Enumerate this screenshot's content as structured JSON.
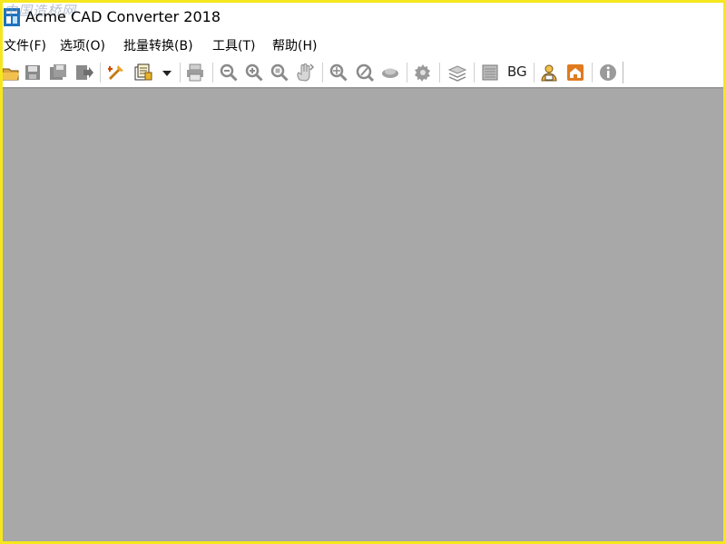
{
  "window": {
    "title": "Acme CAD Converter 2018",
    "watermark": "中国造桥网",
    "frame_color": "#f6e71c"
  },
  "menubar": {
    "items": [
      {
        "label": "文件(F)"
      },
      {
        "label": "选项(O)"
      },
      {
        "label": "批量转换(B)"
      },
      {
        "label": "工具(T)"
      },
      {
        "label": "帮助(H)"
      }
    ]
  },
  "toolbar": {
    "bg_label": "BG",
    "buttons": [
      {
        "icon": "open-icon"
      },
      {
        "icon": "save-icon"
      },
      {
        "icon": "save-as-icon"
      },
      {
        "icon": "export-icon"
      },
      {
        "icon": "convert-icon"
      },
      {
        "icon": "batch-convert-icon"
      },
      {
        "icon": "dropdown-arrow-icon"
      },
      {
        "icon": "print-icon"
      },
      {
        "icon": "zoom-out-icon"
      },
      {
        "icon": "zoom-in-icon"
      },
      {
        "icon": "zoom-window-icon"
      },
      {
        "icon": "pan-icon"
      },
      {
        "icon": "zoom-extents-icon"
      },
      {
        "icon": "zoom-realtime-icon"
      },
      {
        "icon": "view-icon"
      },
      {
        "icon": "settings-icon"
      },
      {
        "icon": "layers-icon"
      },
      {
        "icon": "layout-icon"
      },
      {
        "icon": "background-color-icon"
      },
      {
        "icon": "user-icon"
      },
      {
        "icon": "home-icon"
      },
      {
        "icon": "info-icon"
      }
    ]
  },
  "workspace": {
    "color": "#a8a8a8"
  }
}
